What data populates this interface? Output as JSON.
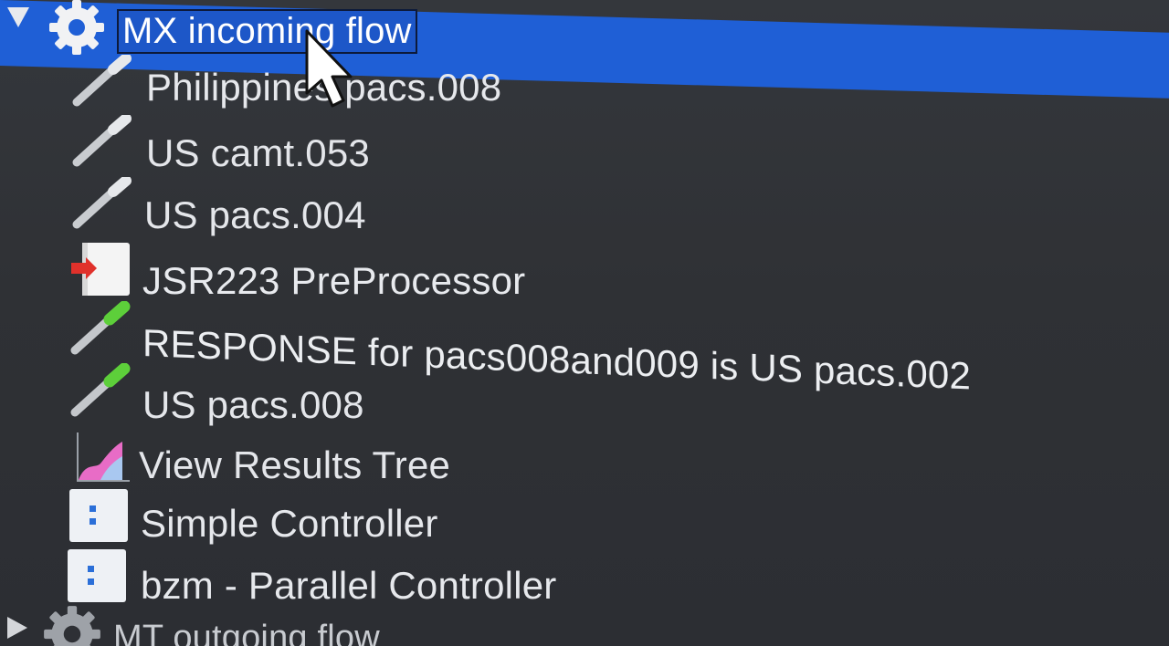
{
  "tree": {
    "items": [
      {
        "label": "MX incoming flow",
        "icon": "gear-icon",
        "expanded": true,
        "selected": true
      },
      {
        "label": "Philippines pacs.008",
        "icon": "pipette-icon"
      },
      {
        "label": "US camt.053",
        "icon": "pipette-icon"
      },
      {
        "label": "US pacs.004",
        "icon": "pipette-icon"
      },
      {
        "label": "JSR223 PreProcessor",
        "icon": "preprocessor-icon"
      },
      {
        "label": "RESPONSE for pacs008and009 is US pacs.002",
        "icon": "pipette-green-icon"
      },
      {
        "label": "US pacs.008",
        "icon": "pipette-green-icon"
      },
      {
        "label": "View Results Tree",
        "icon": "results-tree-icon"
      },
      {
        "label": "Simple Controller",
        "icon": "controller-icon"
      },
      {
        "label": "bzm - Parallel Controller",
        "icon": "controller-icon"
      },
      {
        "label": "MT outgoing flow",
        "icon": "gear-icon",
        "expanded": false
      }
    ]
  },
  "colors": {
    "background": "#2f3136",
    "selection": "#1f5fd6",
    "text": "#e4e6ea"
  }
}
